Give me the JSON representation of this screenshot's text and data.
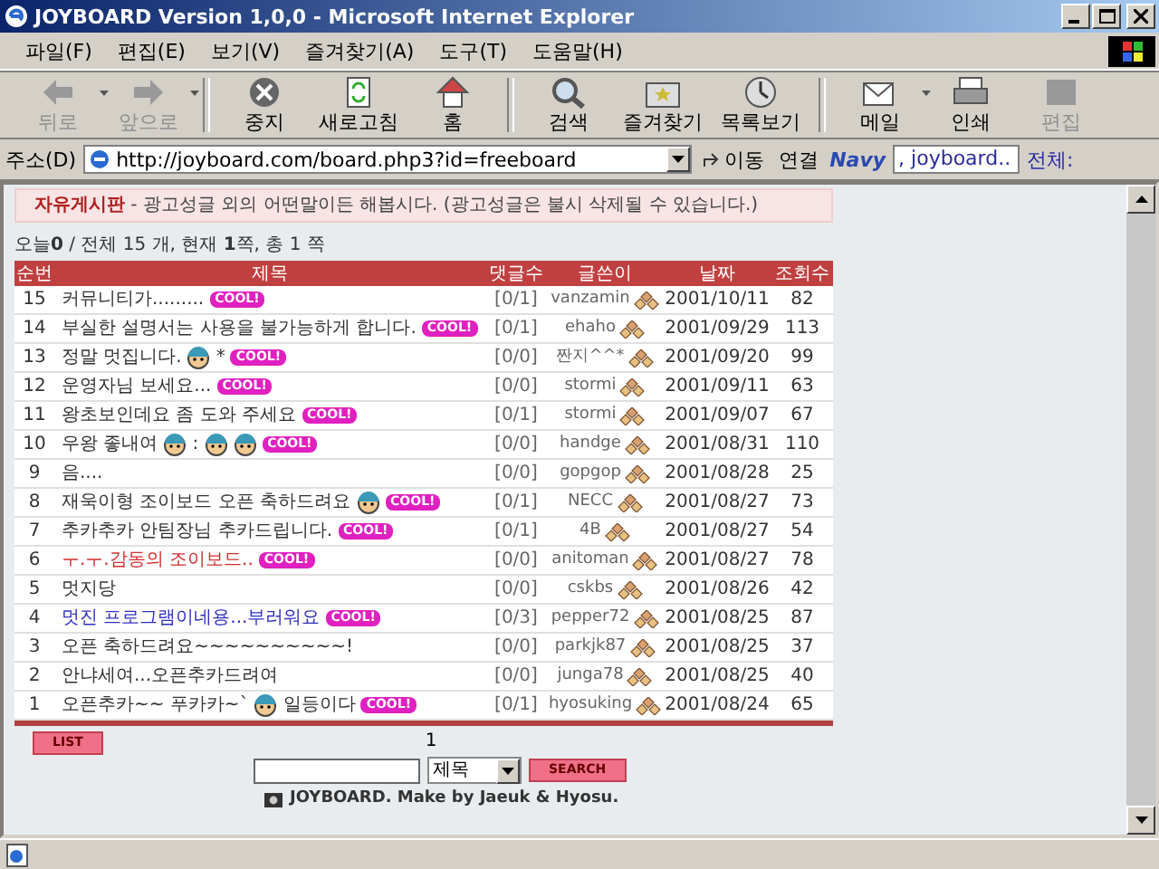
{
  "window": {
    "title": "JOYBOARD Version 1,0,0 - Microsoft Internet Explorer"
  },
  "menu": [
    "파일(F)",
    "편집(E)",
    "보기(V)",
    "즐겨찾기(A)",
    "도구(T)",
    "도움말(H)"
  ],
  "toolbar": [
    {
      "label": "뒤로",
      "disabled": true,
      "dropdown": true
    },
    {
      "label": "앞으로",
      "disabled": true,
      "dropdown": true
    },
    {
      "label": "중지",
      "disabled": false,
      "dropdown": false
    },
    {
      "label": "새로고침",
      "disabled": false,
      "dropdown": false
    },
    {
      "label": "홈",
      "disabled": false,
      "dropdown": false
    },
    {
      "label": "검색",
      "disabled": false,
      "dropdown": false
    },
    {
      "label": "즐겨찾기",
      "disabled": false,
      "dropdown": false
    },
    {
      "label": "목록보기",
      "disabled": false,
      "dropdown": false
    },
    {
      "label": "메일",
      "disabled": false,
      "dropdown": true
    },
    {
      "label": "인쇄",
      "disabled": false,
      "dropdown": false
    },
    {
      "label": "편집",
      "disabled": true,
      "dropdown": false
    }
  ],
  "address_bar": {
    "label": "주소(D)",
    "url": "http://joyboard.com/board.php3?id=freeboard",
    "go": "이동",
    "links": "연결",
    "navy_logo": "Navy",
    "navy_field": ", joyboard..",
    "navy_option": "전체:"
  },
  "notice": {
    "title": "자유게시판",
    "text": " - 광고성글 외의 어떤말이든 해봅시다. (광고성글은 불시 삭제될 수 있습니다.)"
  },
  "summary": "오늘**0** / 전체 15 개, 현재 **1**쪽, 총 1 쪽",
  "table": {
    "columns": [
      "순번",
      "제목",
      "댓글수",
      "글쓴이",
      "날짜",
      "조회수"
    ],
    "rows": [
      {
        "no": "15",
        "title": [
          {
            "kind": "text",
            "text": "커뮤니티가........."
          }
        ],
        "color": "#333333",
        "badge": "COOL!",
        "comments": "[0/1]",
        "author": "vanzamin",
        "date": "2001/10/11",
        "views": "82"
      },
      {
        "no": "14",
        "title": [
          {
            "kind": "text",
            "text": "부실한 설명서는 사용을 불가능하게 합니다."
          }
        ],
        "color": "#333333",
        "badge": "COOL!",
        "comments": "[0/1]",
        "author": "ehaho",
        "date": "2001/09/29",
        "views": "113"
      },
      {
        "no": "13",
        "title": [
          {
            "kind": "text",
            "text": "정말 멋집니다."
          },
          {
            "kind": "face"
          },
          {
            "kind": "text",
            "text": "*"
          }
        ],
        "color": "#333333",
        "badge": "COOL!",
        "comments": "[0/0]",
        "author": "짠지^^*",
        "date": "2001/09/20",
        "views": "99"
      },
      {
        "no": "12",
        "title": [
          {
            "kind": "text",
            "text": "운영자님 보세요..."
          }
        ],
        "color": "#333333",
        "badge": "COOL!",
        "comments": "[0/0]",
        "author": "stormi",
        "date": "2001/09/11",
        "views": "63"
      },
      {
        "no": "11",
        "title": [
          {
            "kind": "text",
            "text": "왕초보인데요 좀 도와 주세요"
          }
        ],
        "color": "#333333",
        "badge": "COOL!",
        "comments": "[0/1]",
        "author": "stormi",
        "date": "2001/09/07",
        "views": "67"
      },
      {
        "no": "10",
        "title": [
          {
            "kind": "text",
            "text": "우왕 좋내여"
          },
          {
            "kind": "face"
          },
          {
            "kind": "text",
            "text": ":"
          },
          {
            "kind": "face"
          },
          {
            "kind": "face"
          }
        ],
        "color": "#333333",
        "badge": "COOL!",
        "comments": "[0/0]",
        "author": "handge",
        "date": "2001/08/31",
        "views": "110"
      },
      {
        "no": "9",
        "title": [
          {
            "kind": "text",
            "text": "음...."
          }
        ],
        "color": "#333333",
        "comments": "[0/0]",
        "author": "gopgop",
        "date": "2001/08/28",
        "views": "25"
      },
      {
        "no": "8",
        "title": [
          {
            "kind": "text",
            "text": "재욱이형 조이보드 오픈 축하드려요"
          },
          {
            "kind": "face"
          }
        ],
        "color": "#333333",
        "badge": "COOL!",
        "comments": "[0/1]",
        "author": "NECC",
        "date": "2001/08/27",
        "views": "73"
      },
      {
        "no": "7",
        "title": [
          {
            "kind": "text",
            "text": "추카추카 안팀장님 추카드립니다."
          }
        ],
        "color": "#333333",
        "badge": "COOL!",
        "comments": "[0/1]",
        "author": "4B",
        "date": "2001/08/27",
        "views": "54"
      },
      {
        "no": "6",
        "title": [
          {
            "kind": "text",
            "text": "ㅜ.ㅜ.감동의 조이보드.."
          }
        ],
        "color": "#d03030",
        "badge": "COOL!",
        "comments": "[0/0]",
        "author": "anitoman",
        "date": "2001/08/27",
        "views": "78"
      },
      {
        "no": "5",
        "title": [
          {
            "kind": "text",
            "text": "멋지당"
          }
        ],
        "color": "#333333",
        "comments": "[0/0]",
        "author": "cskbs",
        "date": "2001/08/26",
        "views": "42"
      },
      {
        "no": "4",
        "title": [
          {
            "kind": "text",
            "text": "멋진 프로그램이네용...부러워요"
          }
        ],
        "color": "#3030c0",
        "badge": "COOL!",
        "comments": "[0/3]",
        "author": "pepper72",
        "date": "2001/08/25",
        "views": "87"
      },
      {
        "no": "3",
        "title": [
          {
            "kind": "text",
            "text": "오픈 축하드려요~~~~~~~~~~!"
          }
        ],
        "color": "#333333",
        "comments": "[0/0]",
        "author": "parkjk87",
        "date": "2001/08/25",
        "views": "37"
      },
      {
        "no": "2",
        "title": [
          {
            "kind": "text",
            "text": "안냐세여...오픈추카드려여"
          }
        ],
        "color": "#333333",
        "comments": "[0/0]",
        "author": "junga78",
        "date": "2001/08/25",
        "views": "40"
      },
      {
        "no": "1",
        "title": [
          {
            "kind": "text",
            "text": "오픈추카~~ 푸카카~`"
          },
          {
            "kind": "face"
          },
          {
            "kind": "text",
            "text": "일등이다"
          }
        ],
        "color": "#333333",
        "badge": "COOL!",
        "comments": "[0/1]",
        "author": "hyosuking",
        "date": "2001/08/24",
        "views": "65"
      }
    ]
  },
  "list_button": "LIST",
  "pages": "1",
  "search": {
    "field": "제목",
    "button": "SEARCH"
  },
  "footer": "JOYBOARD. Make by Jaeuk & Hyosu."
}
